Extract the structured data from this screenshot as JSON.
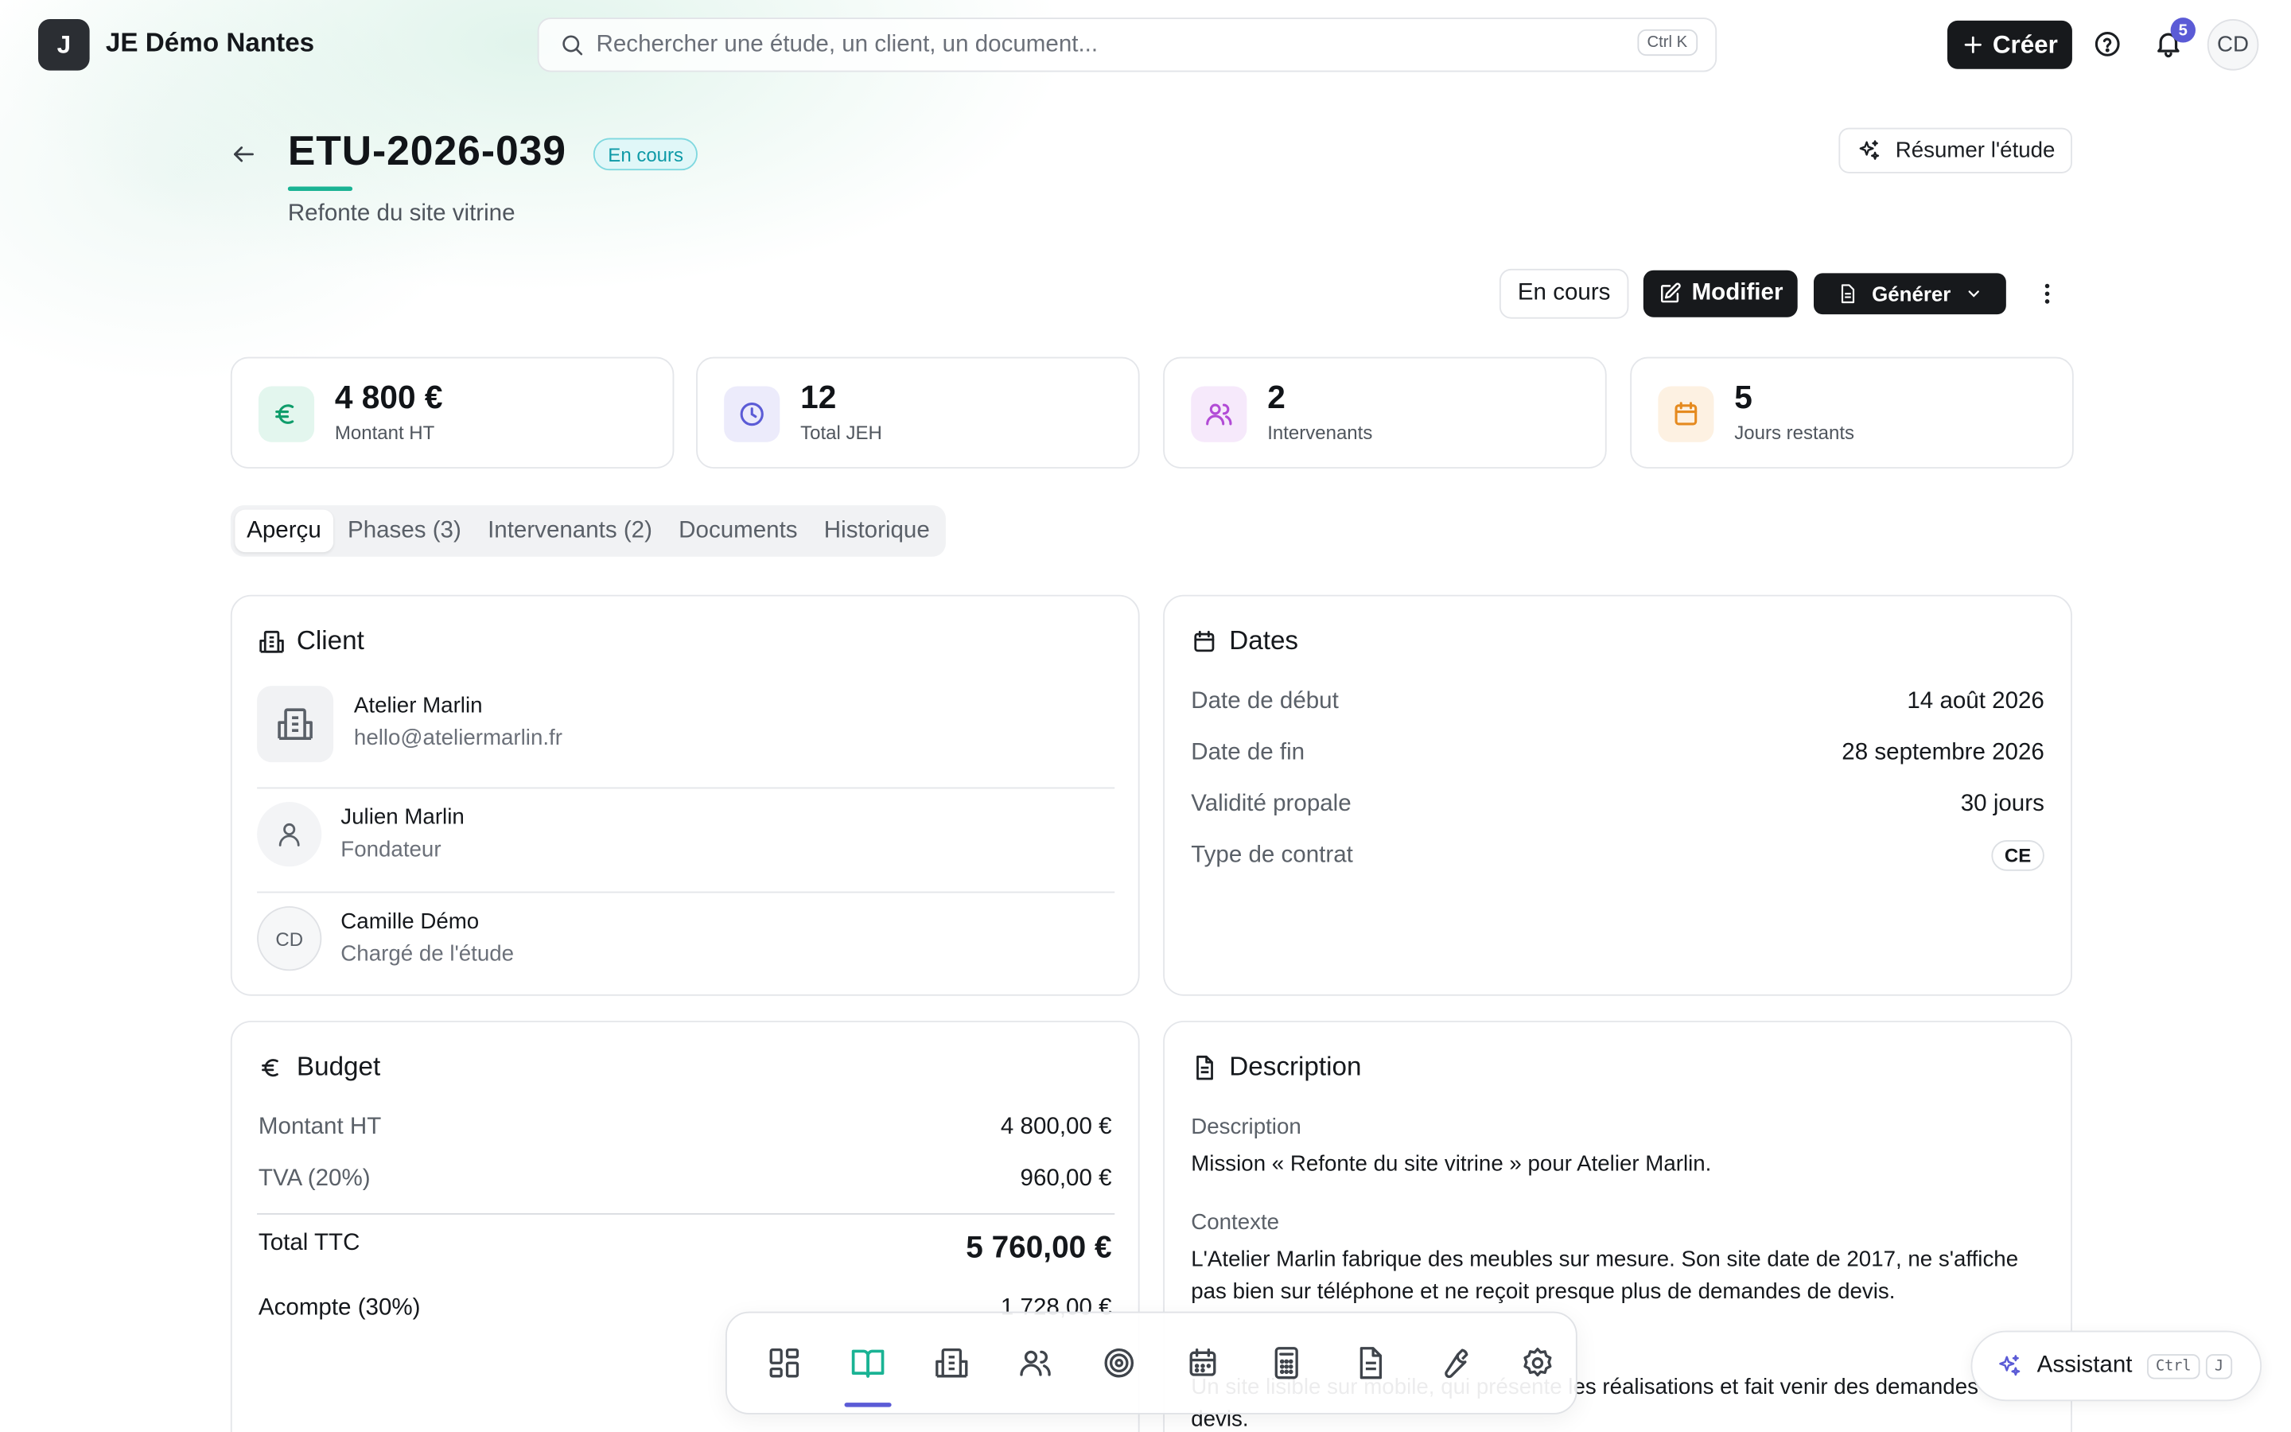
{
  "app": {
    "logo_letter": "J",
    "org_name": "JE Démo Nantes"
  },
  "search": {
    "placeholder": "Rechercher une étude, un client, un document...",
    "shortcut": "Ctrl K"
  },
  "topbar": {
    "create_label": "Créer",
    "notifications_count": "5",
    "user_initials": "CD"
  },
  "study": {
    "id": "ETU-2026-039",
    "status": "En cours",
    "subtitle": "Refonte du site vitrine",
    "summarize_label": "Résumer l'étude"
  },
  "actions": {
    "status_label": "En cours",
    "edit_label": "Modifier",
    "generate_label": "Générer"
  },
  "kpis": [
    {
      "value": "4 800 €",
      "label": "Montant HT",
      "icon": "euro-icon",
      "color": "#0f9d6b",
      "bg": "#e3f6ee"
    },
    {
      "value": "12",
      "label": "Total JEH",
      "icon": "clock-icon",
      "color": "#5b5bd6",
      "bg": "#ecebfb"
    },
    {
      "value": "2",
      "label": "Intervenants",
      "icon": "users-icon",
      "color": "#b24bd6",
      "bg": "#f6e9fb"
    },
    {
      "value": "5",
      "label": "Jours restants",
      "icon": "calendar-icon",
      "color": "#e58a1f",
      "bg": "#fdf1e2"
    }
  ],
  "tabs": [
    "Aperçu",
    "Phases (3)",
    "Intervenants (2)",
    "Documents",
    "Historique"
  ],
  "client_card": {
    "title": "Client",
    "company": {
      "name": "Atelier Marlin",
      "email": "hello@ateliermarlin.fr"
    },
    "contact": {
      "name": "Julien Marlin",
      "role": "Fondateur"
    },
    "manager": {
      "initials": "CD",
      "name": "Camille Démo",
      "role": "Chargé de l'étude"
    }
  },
  "dates_card": {
    "title": "Dates",
    "rows": [
      {
        "label": "Date de début",
        "value": "14 août 2026"
      },
      {
        "label": "Date de fin",
        "value": "28 septembre 2026"
      },
      {
        "label": "Validité propale",
        "value": "30 jours"
      },
      {
        "label": "Type de contrat",
        "value": "CE"
      }
    ]
  },
  "budget_card": {
    "title": "Budget",
    "rows": [
      {
        "label": "Montant HT",
        "value": "4 800,00 €"
      },
      {
        "label": "TVA (20%)",
        "value": "960,00 €"
      }
    ],
    "total_label": "Total TTC",
    "total_value": "5 760,00 €",
    "deposit_label": "Acompte (30%)",
    "deposit_value": "1 728,00 €"
  },
  "description_card": {
    "title": "Description",
    "desc_label": "Description",
    "desc_text": "Mission « Refonte du site vitrine » pour Atelier Marlin.",
    "context_label": "Contexte",
    "context_text": "L'Atelier Marlin fabrique des meubles sur mesure. Son site date de 2017, ne s'affiche pas bien sur téléphone et ne reçoit presque plus de demandes de devis.",
    "objective_text": "Un site lisible sur mobile, qui présente les réalisations et fait venir des demandes de devis."
  },
  "dock": {
    "items": [
      "dashboard-icon",
      "studies-icon",
      "clients-icon",
      "members-icon",
      "targets-icon",
      "calendar-icon",
      "calculator-icon",
      "documents-icon",
      "tools-icon",
      "settings-icon"
    ],
    "active_index": 1,
    "accent": "#1ab394"
  },
  "assistant": {
    "label": "Assistant",
    "key1": "Ctrl",
    "key2": "J"
  }
}
